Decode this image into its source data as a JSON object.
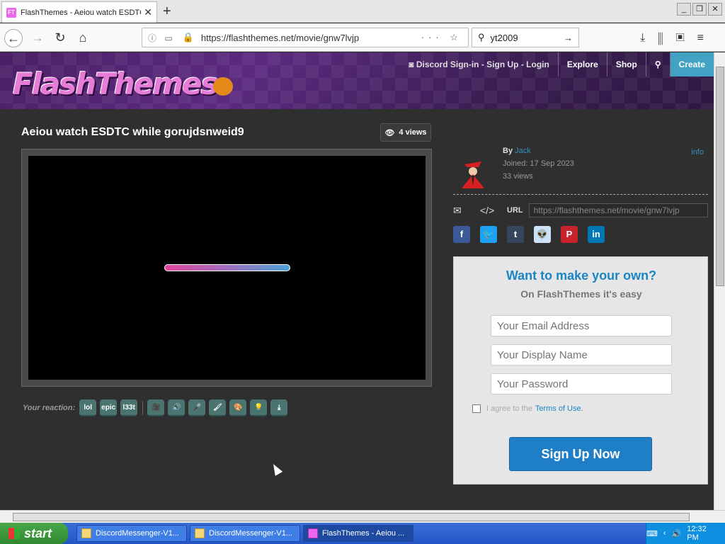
{
  "browser": {
    "tab_title": "FlashThemes - Aeiou watch ESDTC",
    "favicon_text": "FT",
    "url_rest": "https://flashthemes.net/movie/gnw7lvjp",
    "search_query": "yt2009"
  },
  "site": {
    "logo_text": "FlashThemes",
    "nav": {
      "discord": "Discord Sign-in - Sign Up - Login",
      "explore": "Explore",
      "shop": "Shop",
      "create": "Create"
    }
  },
  "movie": {
    "title": "Aeiou watch ESDTC while gorujdsnweid9",
    "views": "4 views",
    "load_progress": 0.5
  },
  "reactions": {
    "label": "Your reaction:",
    "items": [
      "lol",
      "epic",
      "l33t"
    ]
  },
  "author": {
    "by_label": "By",
    "name": "Jack",
    "joined": "Joined: 17 Sep 2023",
    "views": "33 views",
    "info": "info",
    "url_label": "URL",
    "url_value": "https://flashthemes.net/movie/gnw7lvjp"
  },
  "signup": {
    "headline": "Want to make your own?",
    "subline": "On FlashThemes it's easy",
    "email_placeholder": "Your Email Address",
    "name_placeholder": "Your Display Name",
    "password_placeholder": "Your Password",
    "terms_prefix": "I agree to the",
    "terms_link": "Terms of Use.",
    "button": "Sign Up Now"
  },
  "taskbar": {
    "start": "start",
    "tasks": [
      "DiscordMessenger-V1...",
      "DiscordMessenger-V1...",
      "FlashThemes - Aeiou ..."
    ],
    "clock": "12:32 PM"
  },
  "colors": {
    "accent": "#1a86c4",
    "create": "#42a2c4",
    "signup_button": "#1f7fc6"
  }
}
